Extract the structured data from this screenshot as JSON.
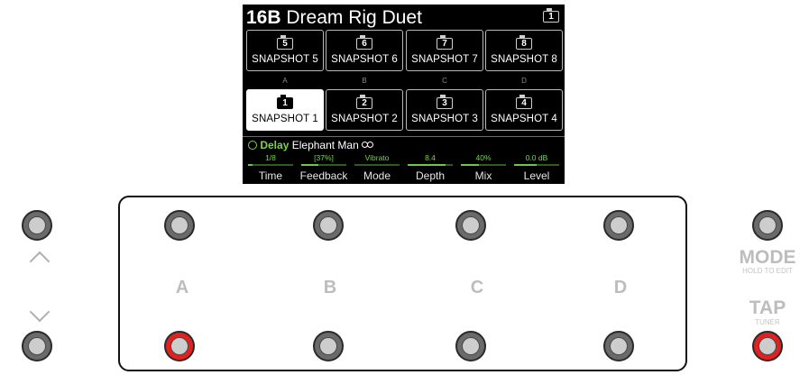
{
  "header": {
    "preset_id": "16B",
    "preset_name": "Dream Rig Duet",
    "icon": "snapshot-icon",
    "icon_number": "1"
  },
  "snapshots": [
    {
      "number": "5",
      "label": "SNAPSHOT 5"
    },
    {
      "number": "6",
      "label": "SNAPSHOT 6"
    },
    {
      "number": "7",
      "label": "SNAPSHOT 7"
    },
    {
      "number": "8",
      "label": "SNAPSHOT 8"
    },
    {
      "number": "1",
      "label": "SNAPSHOT 1",
      "active": true
    },
    {
      "number": "2",
      "label": "SNAPSHOT 2"
    },
    {
      "number": "3",
      "label": "SNAPSHOT 3"
    },
    {
      "number": "4",
      "label": "SNAPSHOT 4"
    }
  ],
  "switch_letters": [
    "A",
    "B",
    "C",
    "D"
  ],
  "block": {
    "category": "Delay",
    "model": "Elephant Man",
    "stereo_icon": "stereo-link-icon"
  },
  "params": [
    {
      "label": "Time",
      "value": "1/8",
      "level": 0.1
    },
    {
      "label": "Feedback",
      "value": "[37%]",
      "level": 0.37
    },
    {
      "label": "Mode",
      "value": "Vibrato",
      "level": 0.0
    },
    {
      "label": "Depth",
      "value": "8.4",
      "level": 0.84
    },
    {
      "label": "Mix",
      "value": "40%",
      "level": 0.4
    },
    {
      "label": "Level",
      "value": "0.0 dB",
      "level": 0.5
    }
  ],
  "footswitch_labels": [
    "A",
    "B",
    "C",
    "D"
  ],
  "mode": {
    "label": "MODE",
    "sub": "HOLD TO EDIT"
  },
  "tap": {
    "label": "TAP",
    "sub": "TUNER"
  },
  "colors": {
    "accent_green": "#7bd34f",
    "footswitch_red": "#e0211f"
  }
}
